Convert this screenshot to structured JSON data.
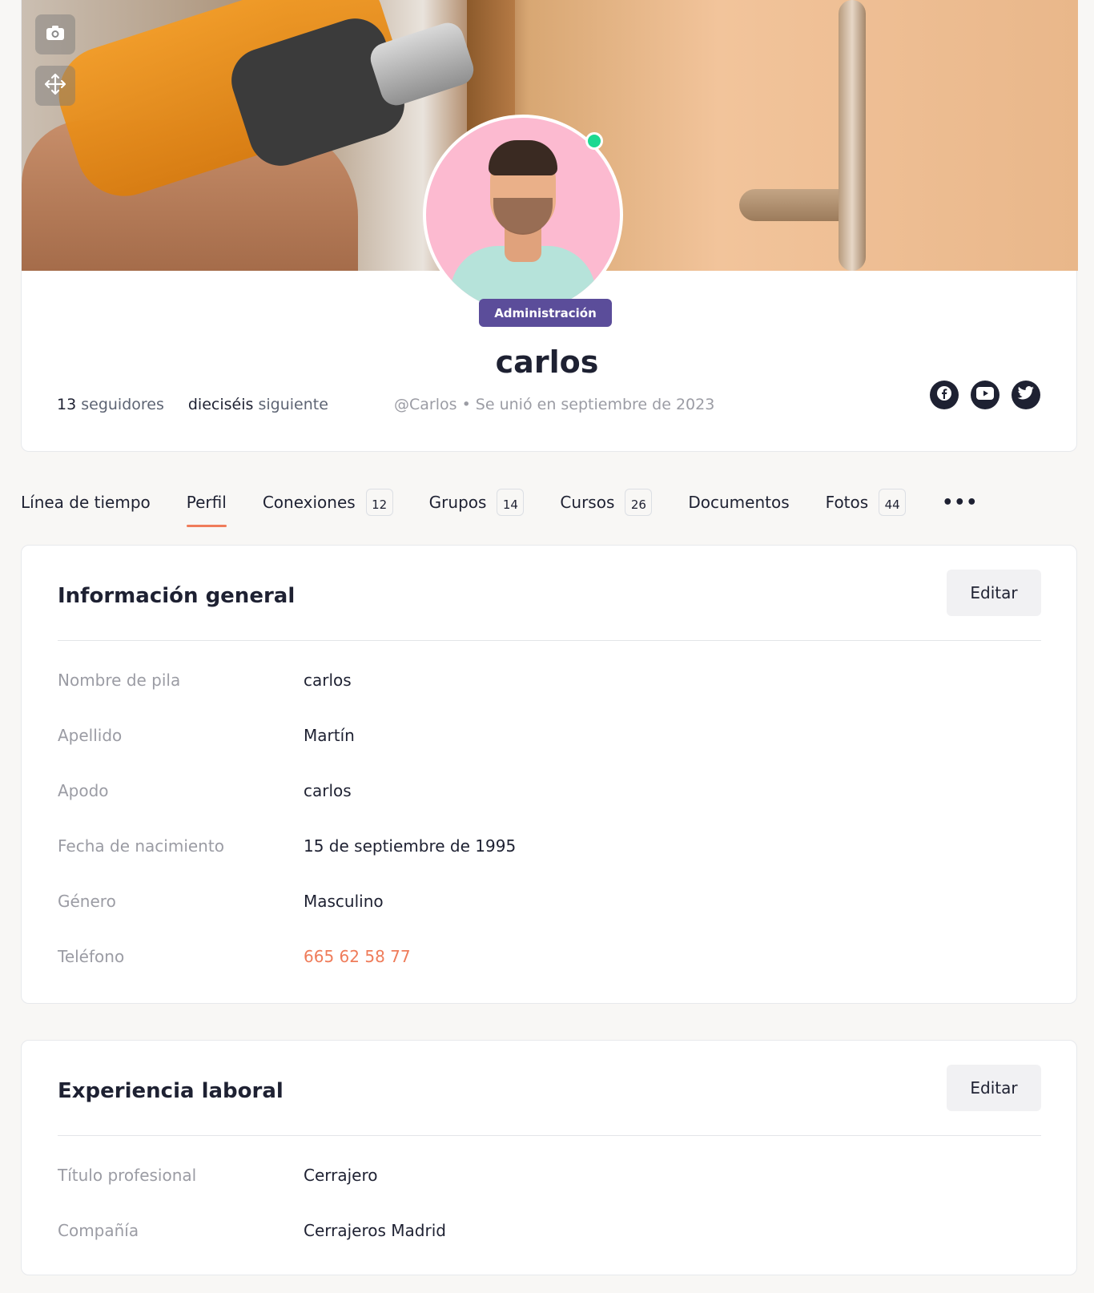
{
  "profile": {
    "role_badge": "Administración",
    "name": "carlos",
    "followers_count": "13",
    "followers_label": "seguidores",
    "following_count": "dieciséis",
    "following_label": "siguiente",
    "handle_line": "@Carlos • Se unió en septiembre de 2023",
    "online": true,
    "social": [
      "facebook-icon",
      "youtube-icon",
      "twitter-icon"
    ]
  },
  "tabs": [
    {
      "label": "Línea de tiempo",
      "count": null
    },
    {
      "label": "Perfil",
      "count": null,
      "active": true
    },
    {
      "label": "Conexiones",
      "count": "12"
    },
    {
      "label": "Grupos",
      "count": "14"
    },
    {
      "label": "Cursos",
      "count": "26"
    },
    {
      "label": "Documentos",
      "count": null
    },
    {
      "label": "Fotos",
      "count": "44"
    },
    {
      "label": "•••",
      "count": null
    }
  ],
  "general": {
    "title": "Información general",
    "edit_label": "Editar",
    "fields": [
      {
        "label": "Nombre de pila",
        "value": "carlos"
      },
      {
        "label": "Apellido",
        "value": "Martín"
      },
      {
        "label": "Apodo",
        "value": "carlos"
      },
      {
        "label": "Fecha de nacimiento",
        "value": "15 de septiembre de 1995"
      },
      {
        "label": "Género",
        "value": "Masculino"
      },
      {
        "label": "Teléfono",
        "value": "665 62 58 77"
      }
    ]
  },
  "work": {
    "title": "Experiencia laboral",
    "edit_label": "Editar",
    "fields": [
      {
        "label": "Título profesional",
        "value": "Cerrajero"
      },
      {
        "label": "Compañía",
        "value": "Cerrajeros Madrid"
      }
    ]
  },
  "colors": {
    "accent": "#ef7c5a",
    "badge": "#5b4d9a",
    "online": "#1cd991"
  }
}
